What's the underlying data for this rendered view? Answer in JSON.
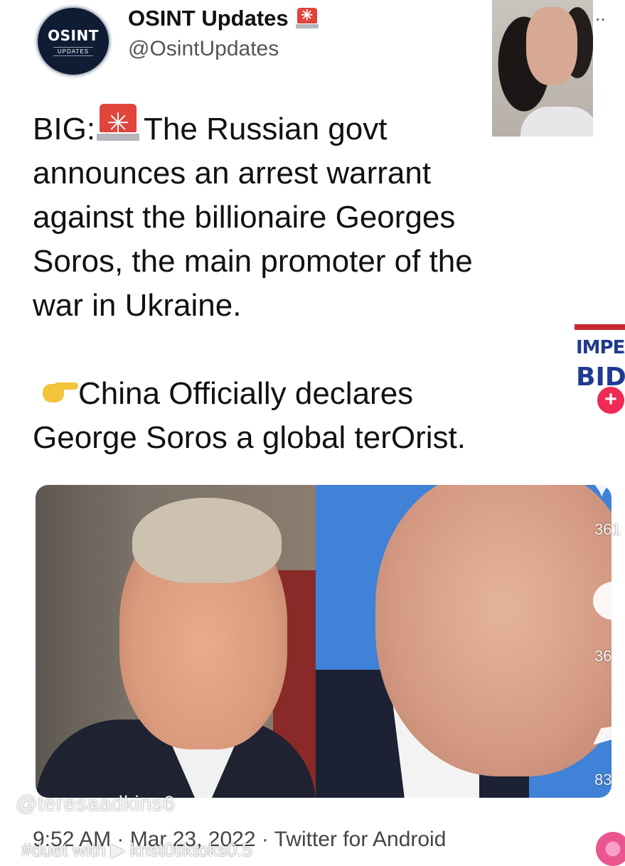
{
  "tweet": {
    "avatar": {
      "main": "OSINT",
      "sub": "UPDATES"
    },
    "display_name": "OSINT Updates",
    "handle": "@OsintUpdates",
    "text_line1_prefix": "BIG:",
    "text_line1_rest": "The Russian govt",
    "text_line2": "announces an arrest warrant",
    "text_line3": "against the billionaire Georges",
    "text_line4": "Soros, the main promoter of the",
    "text_line5": "war in Ukraine.",
    "second_line1": "China Officially declares",
    "second_line2": "George Soros a global terOrist.",
    "meta": "9:52 AM · Mar 23, 2022 · Twitter for Android",
    "more": "··"
  },
  "overlay": {
    "watermark": "@teresaadkins6",
    "duet": "#duet with  ▶ krist0tiktoks0.5",
    "sticker": {
      "line1": "IMPEA",
      "line2": "BIDE"
    },
    "counts": {
      "likes": "361",
      "comments": "36",
      "shares": "83"
    }
  }
}
